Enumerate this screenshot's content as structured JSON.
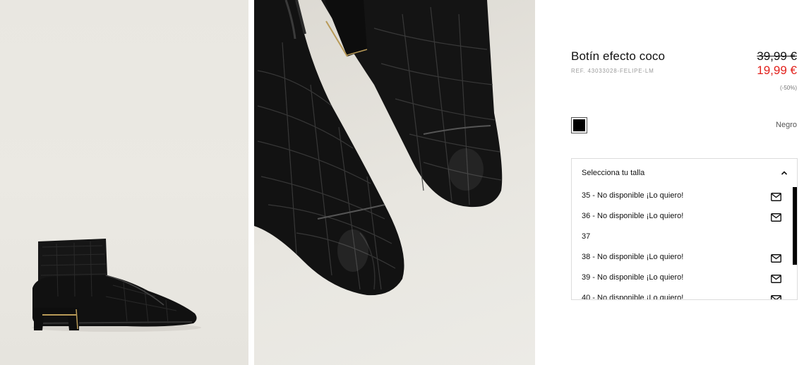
{
  "product": {
    "title": "Botín efecto coco",
    "ref": "REF. 43033028-FELIPE-LM",
    "old_price": "39,99 €",
    "new_price": "19,99 €",
    "discount": "(-50%)"
  },
  "color": {
    "name": "Negro",
    "swatch_color": "#000000"
  },
  "sizes": {
    "header_label": "Selecciona tu talla",
    "items": [
      {
        "label": "35 - No disponible ¡Lo quiero!",
        "icon": "mail-icon"
      },
      {
        "label": "36 - No disponible ¡Lo quiero!",
        "icon": "mail-icon"
      },
      {
        "label": "37",
        "icon": ""
      },
      {
        "label": "38 - No disponible ¡Lo quiero!",
        "icon": "mail-icon"
      },
      {
        "label": "39 - No disponible ¡Lo quiero!",
        "icon": "mail-icon"
      },
      {
        "label": "40 - No disponible ¡Lo quiero!",
        "icon": "mail-icon"
      }
    ]
  },
  "colors": {
    "sale_red": "#e2211c",
    "border": "#dcdcdc"
  }
}
